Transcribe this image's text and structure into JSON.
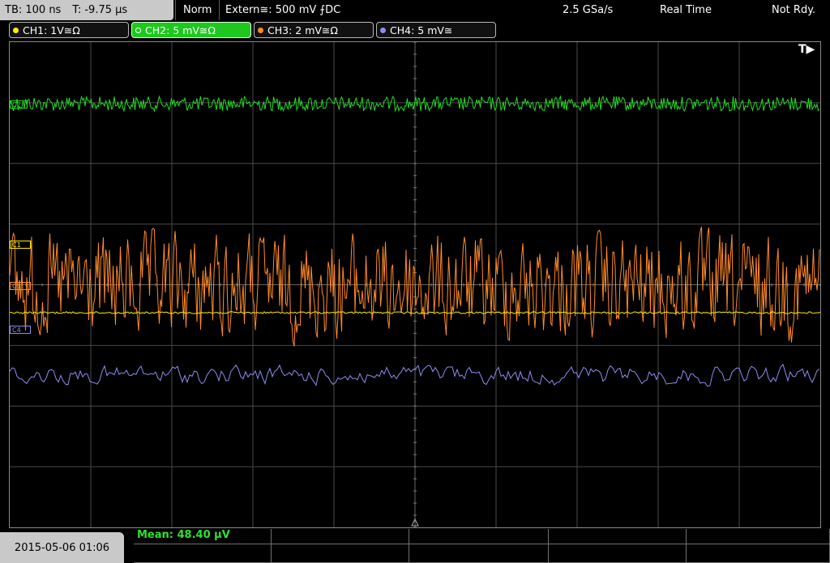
{
  "status_bar": {
    "timebase": "TB: 100 ns",
    "trigger_time": "T: -9.75 µs",
    "mode": "Norm",
    "trigger_source": "Extern≅: 500 mV ⨍DC",
    "sample_rate": "2.5 GSa/s",
    "acquisition": "Real Time",
    "state": "Not Rdy."
  },
  "channels": [
    {
      "label": "CH1: 1V≅Ω",
      "color": "#ffee00",
      "dot": "filled"
    },
    {
      "label": "CH2: 5 mV≅Ω",
      "color": "#22dd22",
      "dot": "ring",
      "active": true
    },
    {
      "label": "CH3: 2 mV≅Ω",
      "color": "#ff8a2a",
      "dot": "filled"
    },
    {
      "label": "CH4: 5 mV≅",
      "color": "#8c8cf0",
      "dot": "filled"
    }
  ],
  "trigger_tag": "T▶",
  "markers": {
    "c1": "C1",
    "c2": "C2",
    "c3": "C3",
    "c4": "C4"
  },
  "measurement": {
    "mean": "Mean: 48.40 µV"
  },
  "datetime": "2015-05-06 01:06",
  "colors": {
    "ch1": "#ffee00",
    "ch2": "#22dd22",
    "ch3": "#ff8a2a",
    "ch4": "#8c8cf0",
    "grid": "#4a4a4a"
  }
}
